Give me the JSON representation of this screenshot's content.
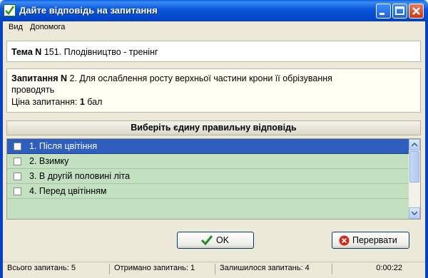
{
  "window": {
    "title": "Дайте відповідь на запитання"
  },
  "menu": {
    "items": [
      "Вид",
      "Допомога"
    ]
  },
  "topic": {
    "label": "Тема N",
    "text": "151. Плодівництво - тренінг"
  },
  "question": {
    "label": "Запитання N",
    "text_line1": "2. Для ослаблення росту верхньої частини крони її обрізування",
    "text_line2": "проводять",
    "price_label": "Ціна запитання:",
    "price_value": "1",
    "price_unit": "бал"
  },
  "answers": {
    "header": "Виберіть єдину правильну відповідь",
    "items": [
      {
        "label": "1. Після цвітіння",
        "checked": false,
        "selected": true
      },
      {
        "label": "2. Взимку",
        "checked": false,
        "selected": false
      },
      {
        "label": "3. В другій половині літа",
        "checked": false,
        "selected": false
      },
      {
        "label": "4. Перед цвітінням",
        "checked": false,
        "selected": false
      }
    ]
  },
  "buttons": {
    "ok_label": "OK",
    "abort_label": "Перервати"
  },
  "status": {
    "total": "Всього запитань: 5",
    "received": "Отримано запитань: 1",
    "remaining": "Залишилося запитань: 4",
    "timer": "0:00:22"
  },
  "icons": {
    "app": "check-icon",
    "ok": "green-check-icon",
    "abort": "red-x-icon"
  },
  "colors": {
    "selection": "#2f5fbe",
    "answers_bg": "#c3e0c0",
    "titlebar": "#0a54d8"
  }
}
